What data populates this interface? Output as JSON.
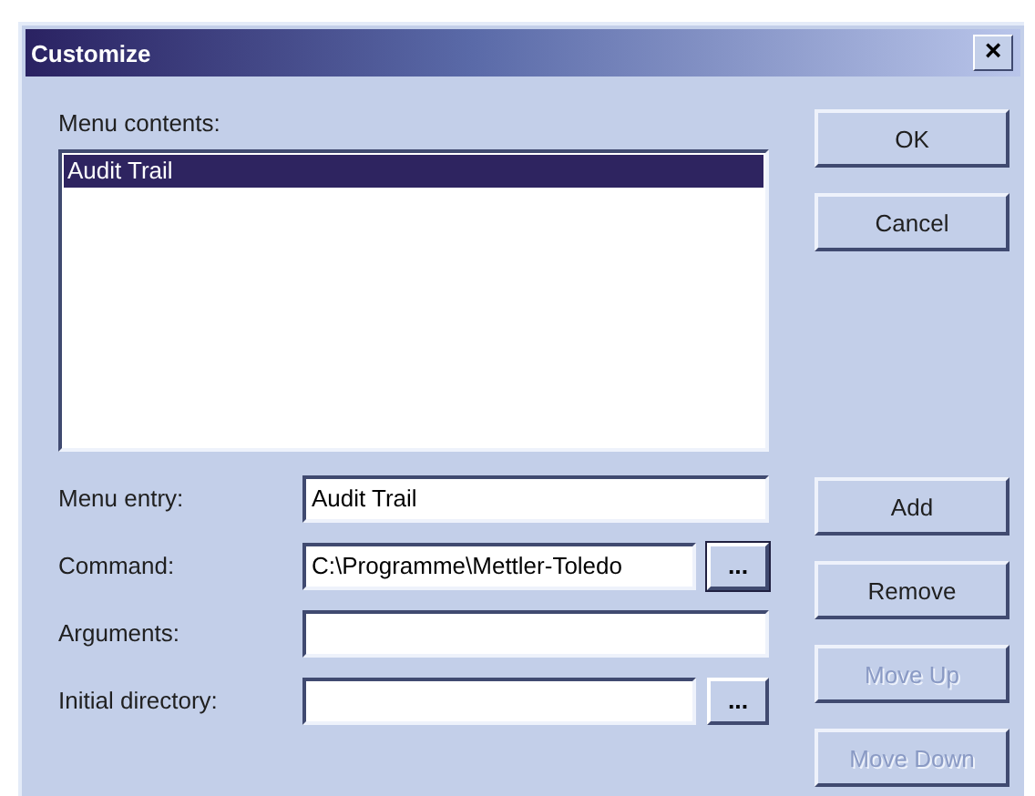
{
  "window": {
    "title": "Customize",
    "close_button": "×"
  },
  "menu_contents": {
    "label": "Menu contents:",
    "items": [
      {
        "label": "Audit Trail",
        "selected": true
      }
    ]
  },
  "fields": [
    {
      "label": "Menu entry:",
      "value": "Audit Trail"
    },
    {
      "label": "Command:",
      "value": "C:\\Programme\\Mettler-Toledo",
      "browse": {
        "label": "...",
        "focused": true
      }
    },
    {
      "label": "Arguments:"
    },
    {
      "label": "Initial directory:",
      "browse": {
        "label": "...",
        "focused": false
      }
    }
  ],
  "top_buttons": [
    {
      "label": "OK",
      "disabled": false
    },
    {
      "label": "Cancel",
      "disabled": false
    }
  ],
  "side_buttons": [
    {
      "label": "Add",
      "disabled": false
    },
    {
      "label": "Remove",
      "disabled": false
    },
    {
      "label": "Move Up",
      "disabled": true
    },
    {
      "label": "Move Down",
      "disabled": true
    }
  ]
}
